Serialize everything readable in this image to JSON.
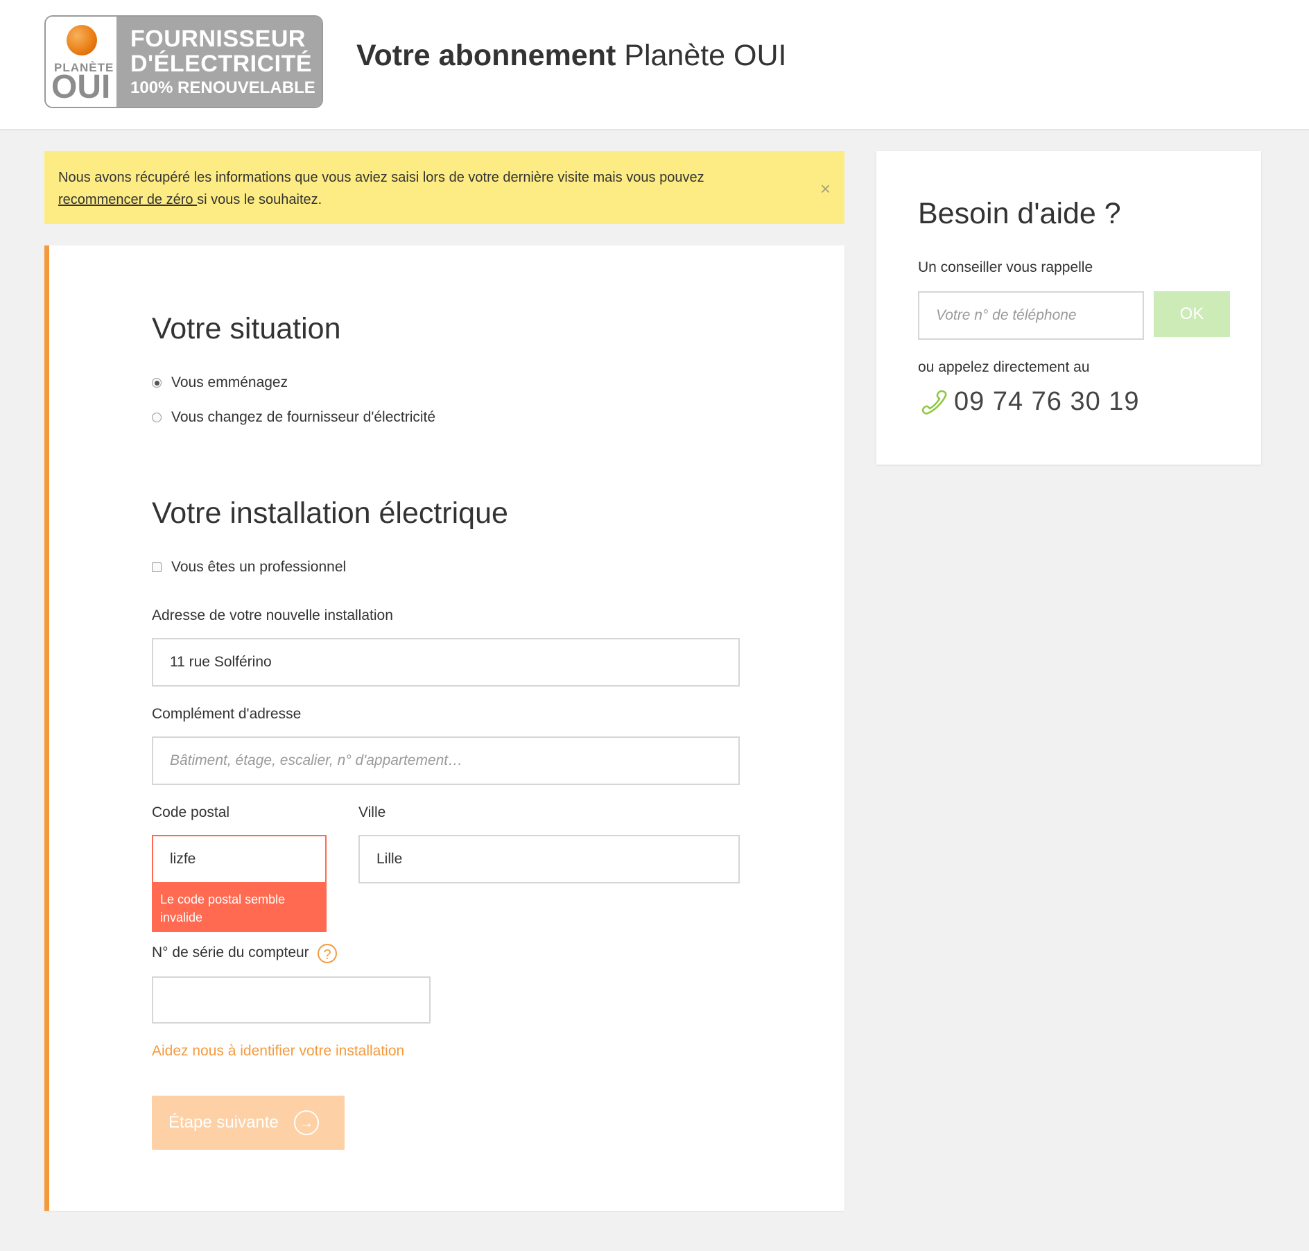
{
  "header": {
    "logo": {
      "brand_small": "PLANÈTE",
      "brand_big": "OUI",
      "tag_line1": "FOURNISSEUR",
      "tag_line2": "D'ÉLECTRICITÉ",
      "tag_line3": "100% RENOUVELABLE"
    },
    "title_bold": "Votre abonnement",
    "title_light": " Planète OUI"
  },
  "alert": {
    "text_before": "Nous avons récupéré les informations que vous aviez saisi lors de votre dernière visite mais vous pouvez",
    "link": "recommencer de zéro ",
    "text_after": "si vous le souhaitez.",
    "close": "×"
  },
  "situation": {
    "title": "Votre situation",
    "options": [
      {
        "label": "Vous emménagez",
        "selected": true
      },
      {
        "label": "Vous changez de fournisseur d'électricité",
        "selected": false
      }
    ]
  },
  "installation": {
    "title": "Votre installation électrique",
    "pro_checkbox": "Vous êtes un professionnel",
    "address_label": "Adresse de votre nouvelle installation",
    "address_value": "11 rue Solférino",
    "complement_label": "Complément d'adresse",
    "complement_placeholder": "Bâtiment, étage, escalier, n° d'appartement…",
    "postal_label": "Code postal",
    "postal_value": "lizfe",
    "postal_error": "Le code postal semble invalide",
    "city_label": "Ville",
    "city_value": "Lille",
    "meter_label": "N° de série du compteur",
    "meter_help": "?",
    "meter_value": "",
    "identify_link": "Aidez nous à identifier votre installation",
    "next_button": "Étape suivante",
    "next_icon": "arrow-right-circle-icon"
  },
  "help": {
    "title": "Besoin d'aide ?",
    "subtitle": "Un conseiller vous rappelle",
    "phone_placeholder": "Votre n° de téléphone",
    "ok_button": "OK",
    "or_text": "ou appelez directement au",
    "phone_icon": "phone-icon",
    "phone_number": "09 74 76 30 19"
  },
  "colors": {
    "accent": "#f59a3c",
    "alert_bg": "#fdec83",
    "error": "#ff6a51",
    "ok_green": "#cdebb6",
    "phone_green": "#8cc63f"
  }
}
